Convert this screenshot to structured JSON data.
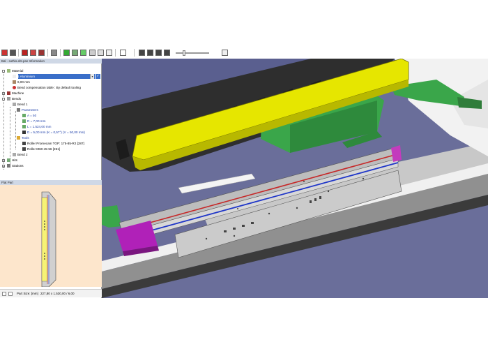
{
  "panel_title": "Bal - sothis.ebt.pse Information",
  "tree": {
    "material_label": "Material",
    "material_value": "1 Aluminium",
    "thickness": "6,00 mm",
    "bend_comp_table": "Bend compensation table : By default tooling",
    "machine_label": "Machine",
    "bends_label": "Bends",
    "bend1_label": "Bend 1",
    "parameters_label": "Parameters",
    "param_a": "A = 50",
    "param_r": "R = 7,00 mm",
    "param_l": "L = 1.524,00 mm",
    "param_d": "D = 5,00 mm (K = 0,57°) (V = 50,00 mm)",
    "tools_label": "Tools",
    "tool_top": "Roller Promecam TOP: 175-85-R2 [287]",
    "tool_bottom": "Roller M60-45-56 [251]",
    "bend2_label": "Bend 2",
    "hits_label": "Hits",
    "stations_label": "Stations"
  },
  "flat_part_title": "Flat Part",
  "part_size_label": "Part Size: [mm]",
  "part_size_value": "227,80 x 1.530,00 / 6,00",
  "colors": {
    "yellow_tool": "#e6e600",
    "green_part": "#3aa64a",
    "purple": "#b021b8",
    "bend_red": "#c62828",
    "bend_blue": "#1f36c8",
    "sheet_grey": "#bdbdbd",
    "background_purple": "#5a5f8f"
  }
}
